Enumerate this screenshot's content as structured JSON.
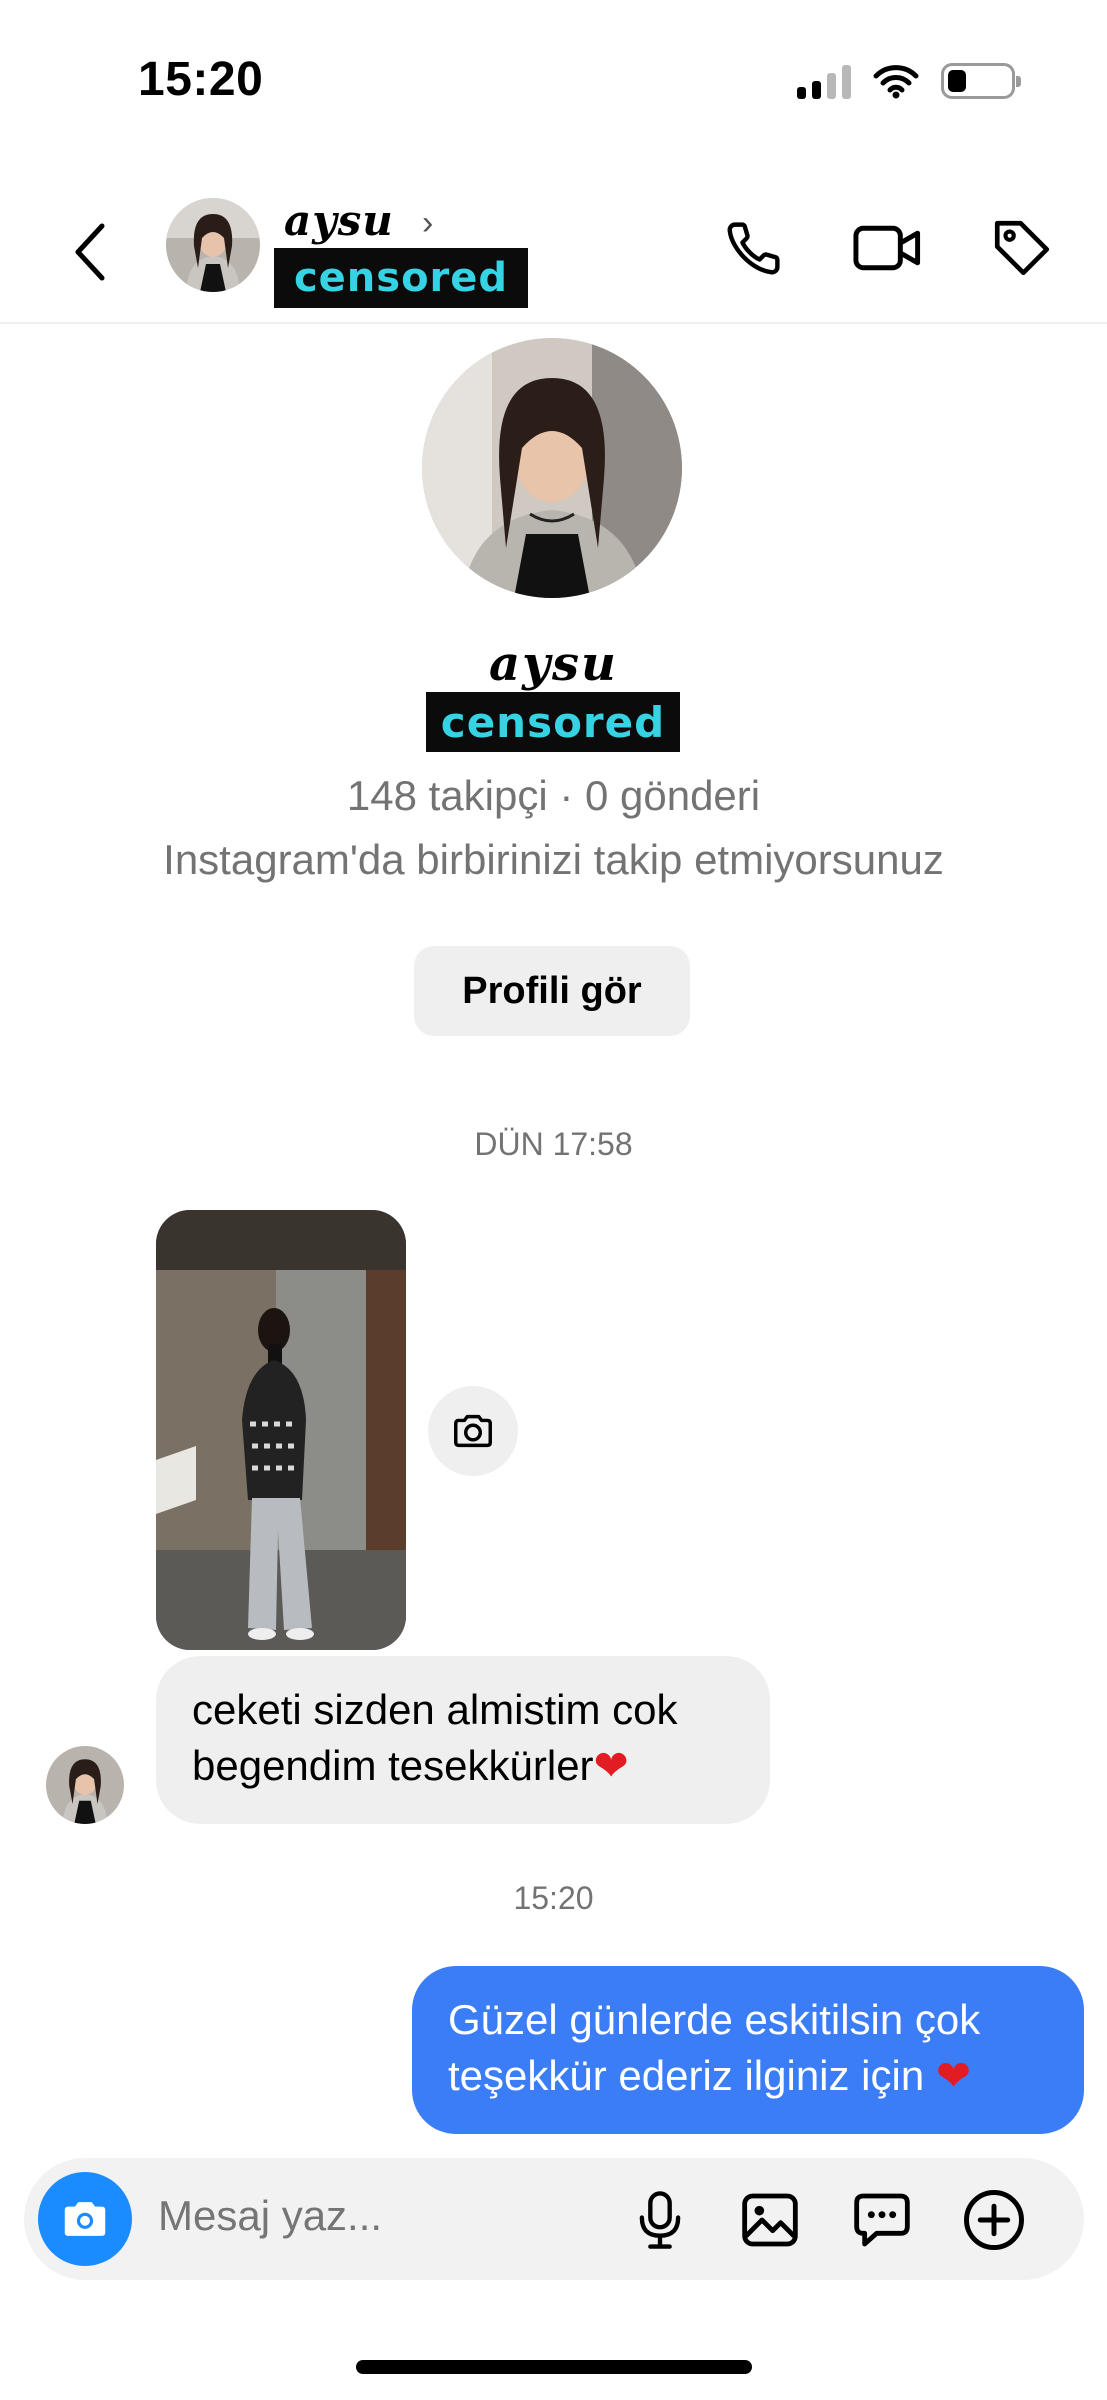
{
  "status_bar": {
    "time": "15:20",
    "icons": [
      "signal-icon",
      "wifi-icon",
      "battery-icon"
    ],
    "battery_level": 0.2
  },
  "header": {
    "back_icon": "chevron-left-icon",
    "name": "aysu",
    "name_chevron": "›",
    "censored_label": "censored",
    "actions": [
      "phone-icon",
      "video-icon",
      "tag-icon"
    ]
  },
  "profile": {
    "name": "aysu",
    "censored_label": "censored",
    "stats": "148 takipçi · 0 gönderi",
    "follow_note": "Instagram'da birbirinizi takip etmiyorsunuz",
    "view_profile_label": "Profili gör"
  },
  "chat": {
    "timestamp_1": "DÜN 17:58",
    "incoming_message_line1": "ceketi sizden almistim cok",
    "incoming_message_line2": "begendim tesekkürler",
    "timestamp_2": "15:20",
    "outgoing_message_line1": "Güzel günlerde eskitilsin çok",
    "outgoing_message_line2": "teşekkür ederiz ilginiz için",
    "heart": "❤"
  },
  "composer": {
    "placeholder": "Mesaj yaz...",
    "icons": [
      "camera-icon",
      "microphone-icon",
      "image-icon",
      "sticker-icon",
      "plus-icon"
    ]
  },
  "colors": {
    "accent": "#3a7df7",
    "camera_button": "#1a8cff",
    "censor_text": "#35d3e4",
    "muted_text": "#737373"
  }
}
